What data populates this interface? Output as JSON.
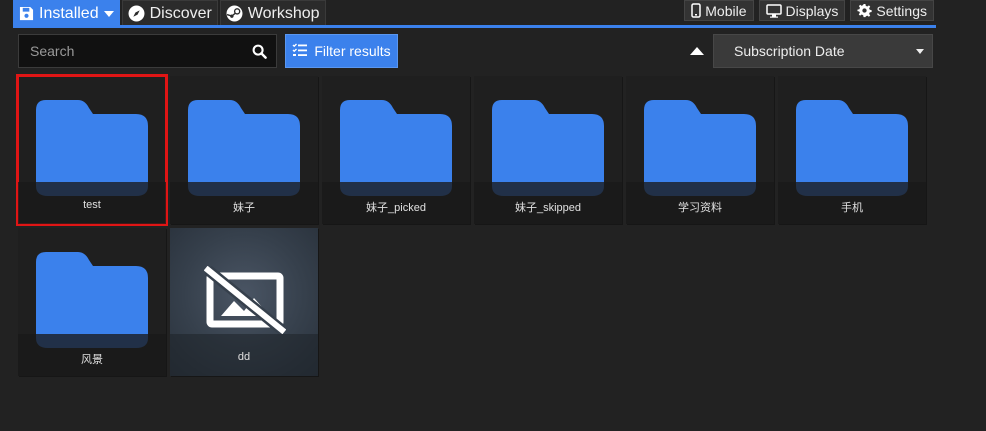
{
  "tabs": [
    {
      "label": "Installed",
      "icon": "floppy-disk-icon",
      "active": true
    },
    {
      "label": "Discover",
      "icon": "compass-icon",
      "active": false
    },
    {
      "label": "Workshop",
      "icon": "steam-icon",
      "active": false
    }
  ],
  "top_buttons": [
    {
      "label": "Mobile",
      "icon": "mobile-icon"
    },
    {
      "label": "Displays",
      "icon": "monitor-icon"
    },
    {
      "label": "Settings",
      "icon": "gear-icon"
    }
  ],
  "search": {
    "placeholder": "Search",
    "value": ""
  },
  "filter_button": {
    "label": "Filter results"
  },
  "sort": {
    "label": "Subscription Date",
    "direction": "ascending"
  },
  "items": [
    {
      "label": "test",
      "type": "folder",
      "selected": true
    },
    {
      "label": "妹子",
      "type": "folder"
    },
    {
      "label": "妹子_picked",
      "type": "folder"
    },
    {
      "label": "妹子_skipped",
      "type": "folder"
    },
    {
      "label": "学习资料",
      "type": "folder"
    },
    {
      "label": "手机",
      "type": "folder"
    },
    {
      "label": "风景",
      "type": "folder"
    },
    {
      "label": "dd",
      "type": "no-preview-image"
    }
  ],
  "colors": {
    "accent": "#3b81ec",
    "folder": "#3b81ec",
    "selection": "#e01515",
    "background": "#222222"
  }
}
